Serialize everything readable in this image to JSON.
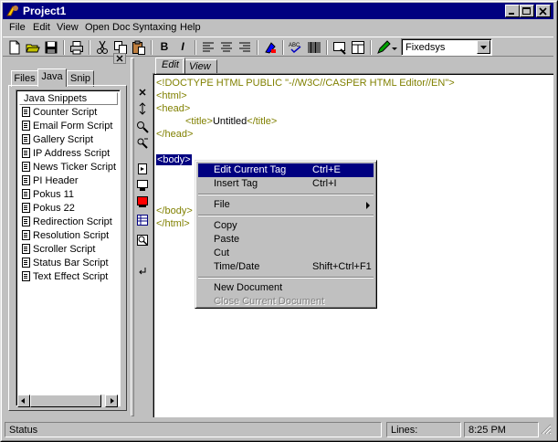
{
  "window": {
    "title": "Project1"
  },
  "menu": [
    "File",
    "Edit",
    "View",
    "Open Doc",
    "Syntaxing",
    "Help"
  ],
  "toolbar": {
    "font_select": "Fixedsys",
    "buttons": [
      "new-icon",
      "open-icon",
      "save-icon",
      "print-icon",
      "cut-icon",
      "copy-icon",
      "paste-icon",
      "bold-icon",
      "italic-icon",
      "align-left-icon",
      "align-center-icon",
      "align-right-icon",
      "color-icon",
      "spellcheck-icon",
      "barcode-icon",
      "preview-icon",
      "frame-icon",
      "pen-icon"
    ]
  },
  "left_panel": {
    "tabs": [
      "Files",
      "Java",
      "Snip"
    ],
    "active_tab": "Java",
    "list_header": "Java Snippets",
    "snippets": [
      "Counter Script",
      "Email Form Script",
      "Gallery Script",
      "IP Address Script",
      "News Ticker Script",
      "PI Header",
      "Pokus 11",
      "Pokus 22",
      "Redirection Script",
      "Resolution Script",
      "Scroller Script",
      "Status Bar Script",
      "Text Effect Script"
    ]
  },
  "editor": {
    "tabs": [
      "Edit",
      "View"
    ],
    "active_tab": "Edit",
    "lines": {
      "doctype": "<!DOCTYPE HTML PUBLIC \"-//W3C//CASPER HTML Editor//EN\">",
      "html_open": "<html>",
      "head_open": "<head>",
      "title_open": "<title>",
      "title_text": "Untitled",
      "title_close": "</title>",
      "head_close": "</head>",
      "body_open": "<body>",
      "body_close": "</body>",
      "html_close": "</html>"
    }
  },
  "context_menu": {
    "items": [
      {
        "label": "Edit Current Tag",
        "shortcut": "Ctrl+E"
      },
      {
        "label": "Insert Tag",
        "shortcut": "Ctrl+I"
      },
      {
        "label": "File",
        "shortcut": ""
      },
      {
        "label": "Copy",
        "shortcut": ""
      },
      {
        "label": "Paste",
        "shortcut": ""
      },
      {
        "label": "Cut",
        "shortcut": ""
      },
      {
        "label": "Time/Date",
        "shortcut": "Shift+Ctrl+F1"
      },
      {
        "label": "New Document",
        "shortcut": ""
      },
      {
        "label": "Close Current Document",
        "shortcut": ""
      }
    ]
  },
  "status": {
    "text": "Status",
    "lines_label": "Lines:",
    "time": "8:25 PM"
  },
  "colors": {
    "titlebar": "#000080",
    "face": "#c0c0c0",
    "tag": "#808000",
    "selection": "#000080"
  }
}
